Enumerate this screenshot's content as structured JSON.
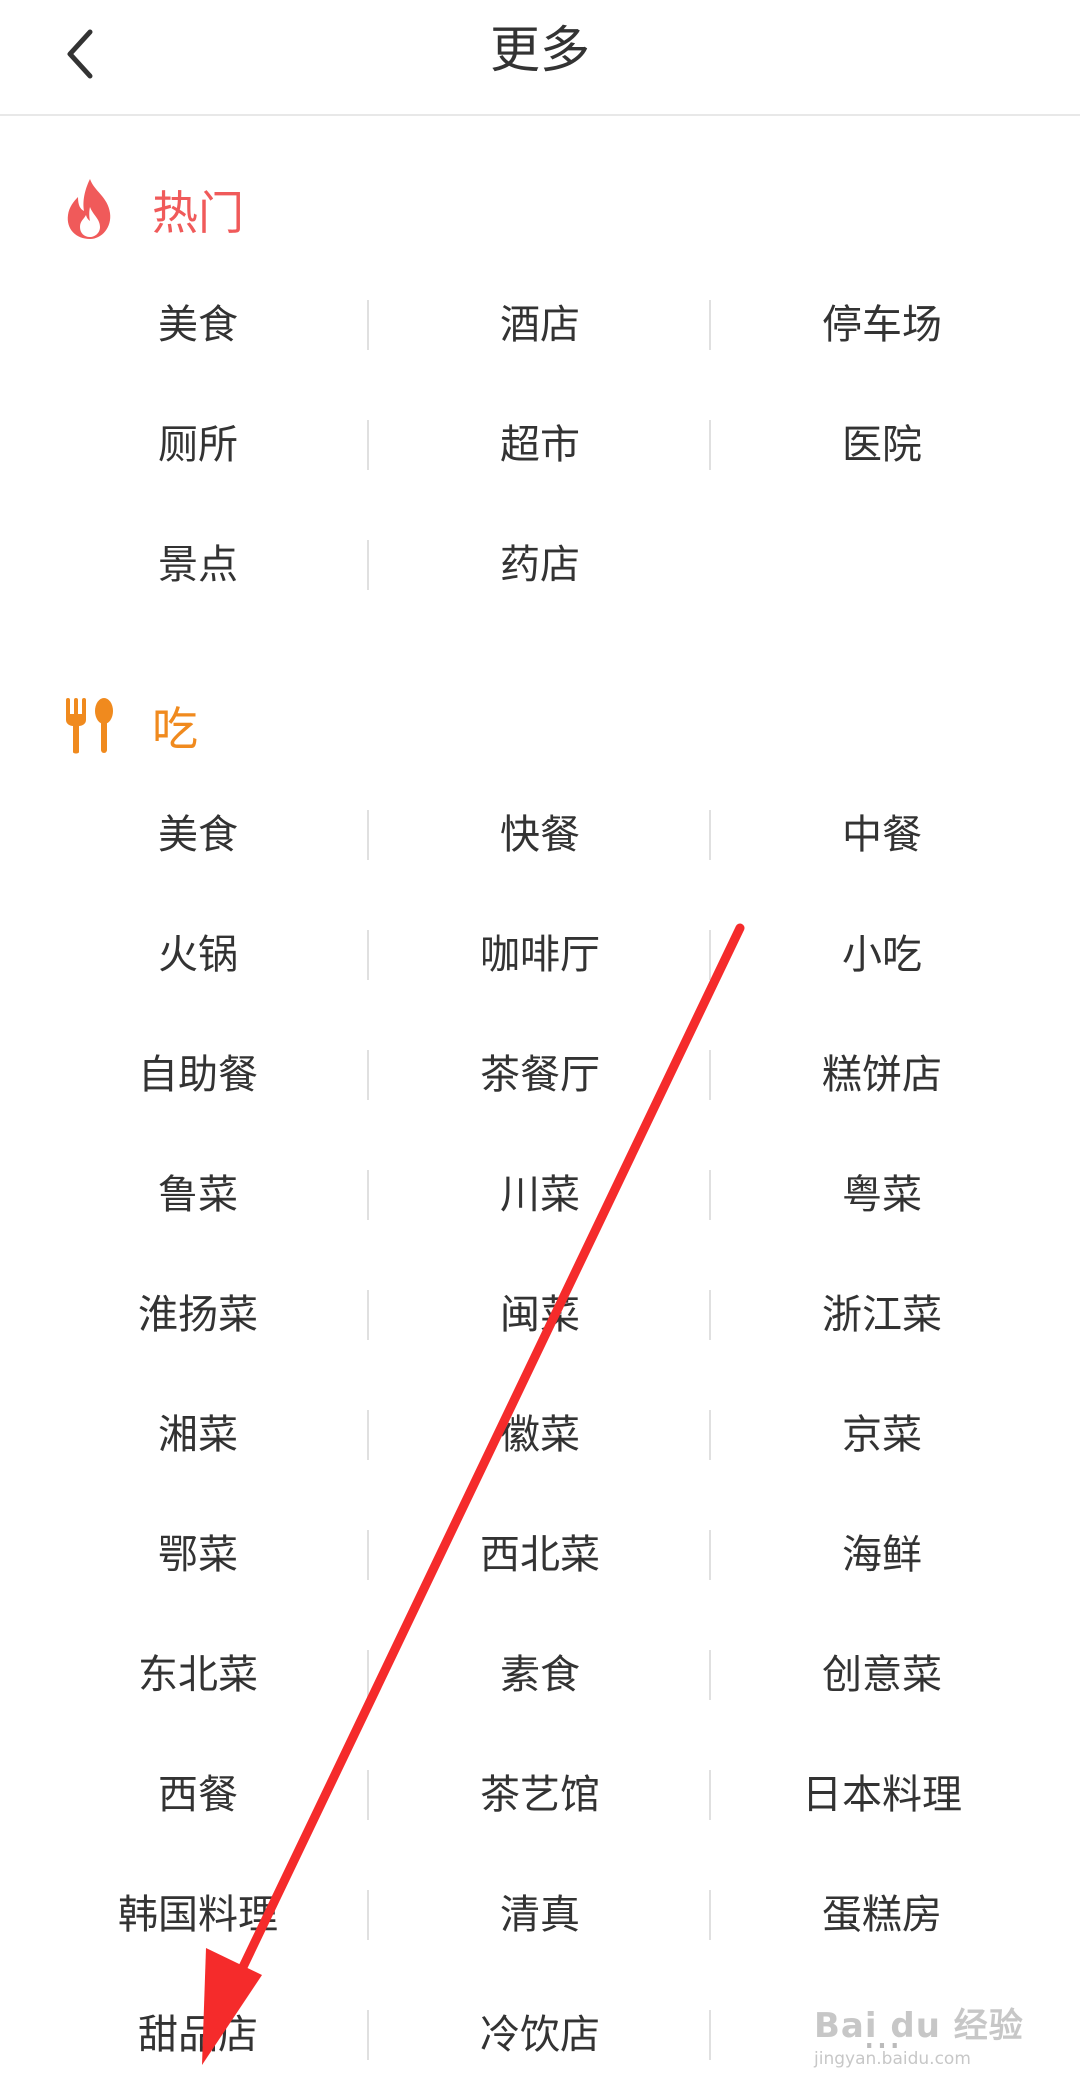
{
  "header": {
    "title": "更多",
    "back_icon": "chevron-left-icon"
  },
  "sections": [
    {
      "title": "热门",
      "icon": "fire-icon",
      "color": "#f05a5a",
      "items": [
        "美食",
        "酒店",
        "停车场",
        "厕所",
        "超市",
        "医院",
        "景点",
        "药店"
      ]
    },
    {
      "title": "吃",
      "icon": "fork-spoon-icon",
      "color": "#f08a1e",
      "items": [
        "美食",
        "快餐",
        "中餐",
        "火锅",
        "咖啡厅",
        "小吃",
        "自助餐",
        "茶餐厅",
        "糕饼店",
        "鲁菜",
        "川菜",
        "粤菜",
        "淮扬菜",
        "闽菜",
        "浙江菜",
        "湘菜",
        "徽菜",
        "京菜",
        "鄂菜",
        "西北菜",
        "海鲜",
        "东北菜",
        "素食",
        "创意菜",
        "西餐",
        "茶艺馆",
        "日本料理",
        "韩国料理",
        "清真",
        "蛋糕房",
        "甜品店",
        "冷饮店",
        "..."
      ]
    }
  ],
  "annotation": {
    "arrow_color": "#f52b2b",
    "arrow_icon": "red-arrow-icon"
  },
  "watermark": {
    "logo": "Bai du 经验",
    "url": "jingyan.baidu.com"
  }
}
